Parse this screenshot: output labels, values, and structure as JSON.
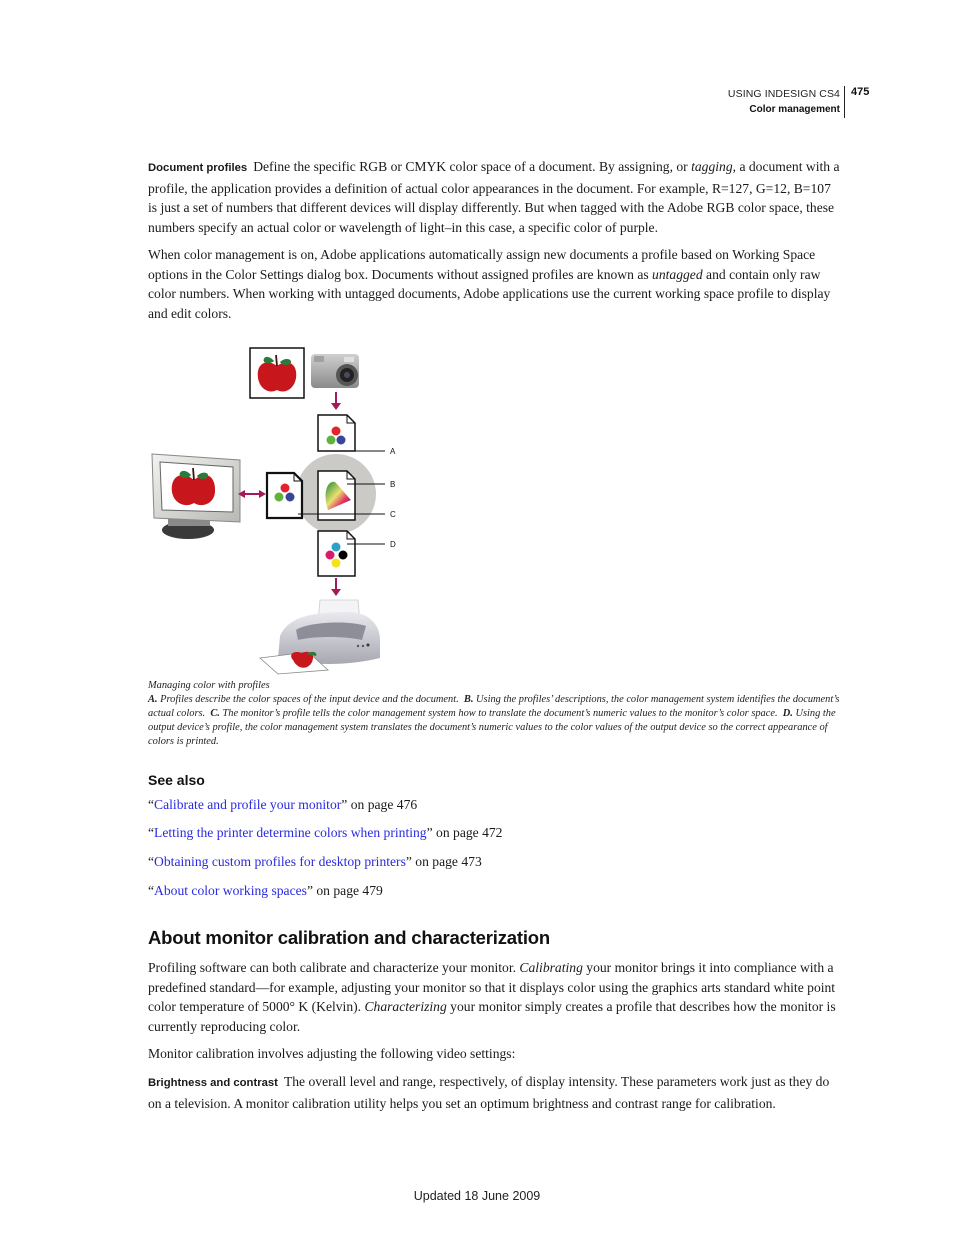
{
  "header": {
    "book_title": "USING INDESIGN CS4",
    "section": "Color management",
    "page_number": "475"
  },
  "document_profiles": {
    "term": "Document profiles",
    "text_1": "Define the specific RGB or CMYK color space of a document. By assigning, or ",
    "text_1_em": "tagging",
    "text_2": ", a document with a profile, the application provides a definition of actual color appearances in the document. For example, R=127, G=12, B=107 is just a set of numbers that different devices will display differently. But when tagged with the Adobe RGB color space, these numbers specify an actual color or wavelength of light–in this case, a specific color of purple."
  },
  "paragraph_2": {
    "text_1": "When color management is on, Adobe applications automatically assign new documents a profile based on Working Space options in the Color Settings dialog box. Documents without assigned profiles are known as ",
    "text_1_em": "untagged",
    "text_2": " and contain only raw color numbers. When working with untagged documents, Adobe applications use the current working space profile to display and edit colors."
  },
  "figure": {
    "callouts": [
      "A",
      "B",
      "C",
      "D"
    ],
    "colors": {
      "arrow": "#a3195b",
      "rgb_red": "#e2232e",
      "rgb_green": "#5fb33c",
      "rgb_blue": "#3b4597",
      "cmyk_cyan": "#2fa0c8",
      "cmyk_magenta": "#d81a6a",
      "cmyk_yellow": "#f4e21a",
      "cmyk_black": "#000000",
      "circle": "#cbcac6",
      "apple": "#c8161d",
      "leaf": "#2c7a3a"
    }
  },
  "caption": {
    "title": "Managing color with profiles",
    "items": [
      {
        "label": "A.",
        "text": "Profiles describe the color spaces of the input device and the document."
      },
      {
        "label": "B.",
        "text": "Using the profiles’ descriptions, the color management system identifies the document’s actual colors."
      },
      {
        "label": "C.",
        "text": "The monitor’s profile tells the color management system how to translate the document’s numeric values to the monitor’s color space."
      },
      {
        "label": "D.",
        "text": "Using the output device’s profile, the color management system translates the document’s numeric values to the color values of the output device so the correct appearance of colors is printed."
      }
    ]
  },
  "see_also": {
    "title": "See also",
    "links": [
      {
        "text": "Calibrate and profile your monitor",
        "suffix": "” on page 476"
      },
      {
        "text": "Letting the printer determine colors when printing",
        "suffix": "” on page 472"
      },
      {
        "text": "Obtaining custom profiles for desktop printers",
        "suffix": "” on page 473"
      },
      {
        "text": "About color working spaces",
        "suffix": "” on page 479"
      }
    ],
    "open_quote": "“"
  },
  "section": {
    "heading": "About monitor calibration and characterization",
    "p1_a": "Profiling software can both calibrate and characterize your monitor. ",
    "p1_em1": "Calibrating",
    "p1_b": " your monitor brings it into compliance with a predefined standard—for example, adjusting your monitor so that it displays color using the graphics arts standard white point color temperature of 5000° K (Kelvin). ",
    "p1_em2": "Characterizing",
    "p1_c": " your monitor simply creates a profile that describes how the monitor is currently reproducing color.",
    "p2": "Monitor calibration involves adjusting the following video settings:",
    "p3_term": "Brightness and contrast",
    "p3_text": "The overall level and range, respectively, of display intensity. These parameters work just as they do on a television. A monitor calibration utility helps you set an optimum brightness and contrast range for calibration."
  },
  "footer": {
    "text": "Updated 18 June 2009"
  }
}
